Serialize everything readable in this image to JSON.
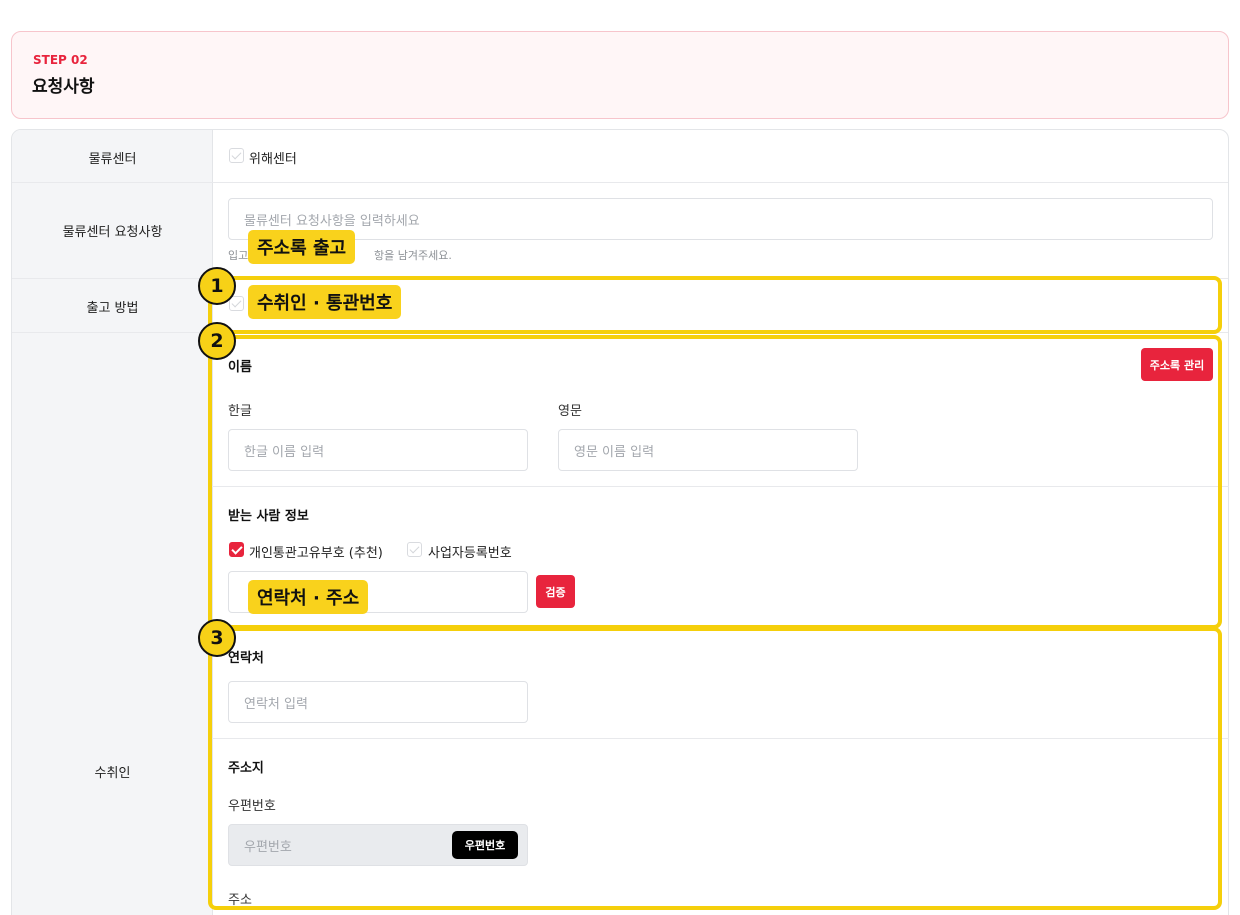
{
  "step": {
    "label": "STEP 02",
    "title": "요청사항"
  },
  "rows": {
    "center": {
      "label": "물류센터",
      "option": "위해센터"
    },
    "center_request": {
      "label": "물류센터 요청사항",
      "placeholder": "물류센터 요청사항을 입력하세요",
      "help_prefix": "입고",
      "help_suffix": "항을 남겨주세요."
    },
    "shipping_method": {
      "label": "출고 방법"
    },
    "recipient": {
      "label": "수취인"
    }
  },
  "name_section": {
    "title": "이름",
    "address_book_button": "주소록 관리",
    "korean_label": "한글",
    "korean_placeholder": "한글 이름 입력",
    "english_label": "영문",
    "english_placeholder": "영문 이름 입력"
  },
  "receiver_info": {
    "title": "받는 사람 정보",
    "option_customs": "개인통관고유부호 (추천)",
    "option_business": "사업자등록번호",
    "verify_button": "검증"
  },
  "contact": {
    "title": "연락처",
    "placeholder": "연락처 입력"
  },
  "address": {
    "title": "주소지",
    "postcode_label": "우편번호",
    "postcode_placeholder": "우편번호",
    "postcode_button": "우편번호",
    "address_label": "주소"
  },
  "annotations": {
    "tag_address_book": "주소록 출고",
    "tag_recipient": "수취인 · 통관번호",
    "tag_contact": "연락처 · 주소",
    "badge_1": "1",
    "badge_2": "2",
    "badge_3": "3"
  },
  "colors": {
    "accent": "#e8243d",
    "highlight": "#f5cf0b"
  }
}
